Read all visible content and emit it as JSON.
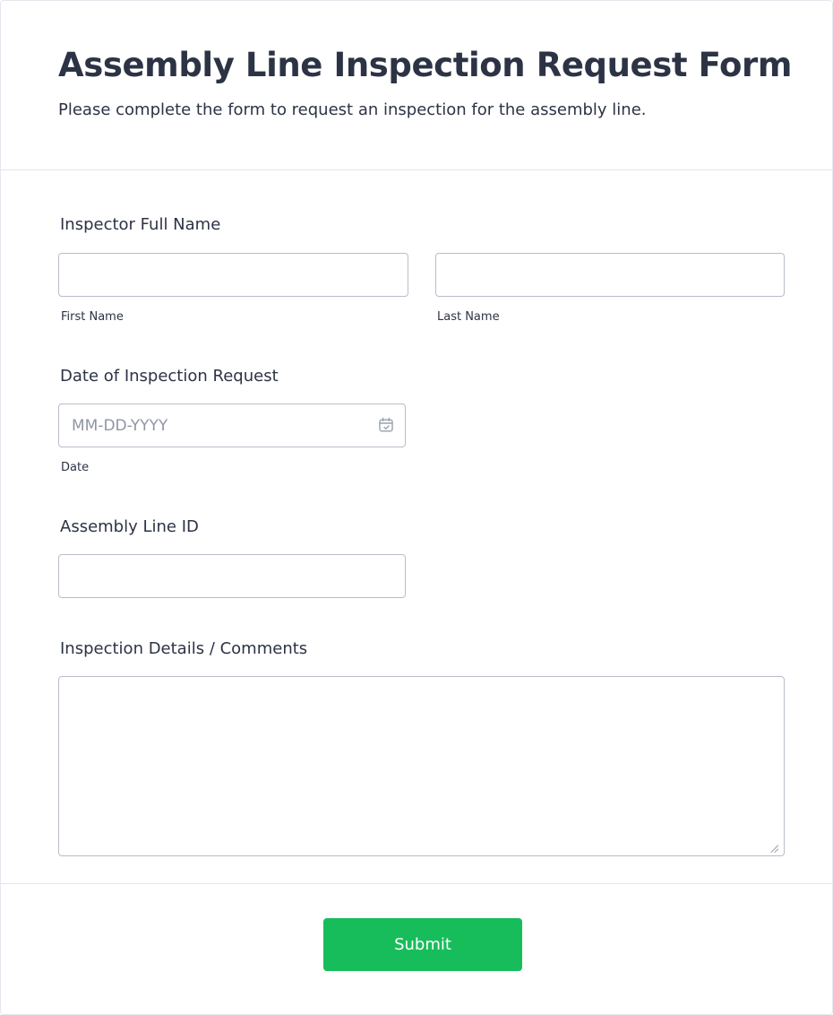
{
  "form": {
    "title": "Assembly Line Inspection Request Form",
    "subtitle": "Please complete the form to request an inspection for the assembly line."
  },
  "fields": {
    "inspector_name": {
      "label": "Inspector Full Name",
      "first_sublabel": "First Name",
      "last_sublabel": "Last Name",
      "first_value": "",
      "last_value": ""
    },
    "date": {
      "label": "Date of Inspection Request",
      "placeholder": "MM-DD-YYYY",
      "sublabel": "Date",
      "value": "",
      "icon": "calendar-icon"
    },
    "assembly_line_id": {
      "label": "Assembly Line ID",
      "value": ""
    },
    "comments": {
      "label": "Inspection Details / Comments",
      "value": ""
    }
  },
  "submit": {
    "label": "Submit",
    "color": "#18bd5b"
  },
  "colors": {
    "text": "#2c3345",
    "border": "#b8bdc9",
    "divider": "#e3e5ec"
  }
}
